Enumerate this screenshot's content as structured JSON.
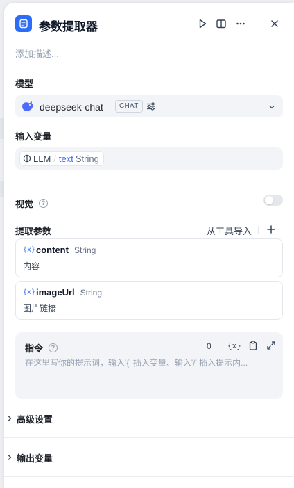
{
  "header": {
    "title": "参数提取器",
    "description_placeholder": "添加描述..."
  },
  "model": {
    "label": "模型",
    "name": "deepseek-chat",
    "mode_badge": "CHAT"
  },
  "input": {
    "label": "输入变量",
    "source_node": "LLM",
    "separator": "/",
    "variable": "text",
    "type": "String"
  },
  "vision": {
    "label": "视觉",
    "enabled": false
  },
  "extract": {
    "label": "提取参数",
    "import_label": "从工具导入",
    "params": [
      {
        "icon": "{x}",
        "name": "content",
        "type": "String",
        "description": "内容"
      },
      {
        "icon": "{x}",
        "name": "imageUrl",
        "type": "String",
        "description": "图片链接"
      }
    ]
  },
  "instruction": {
    "label": "指令",
    "count": "0",
    "var_label": "{x}",
    "placeholder": "在这里写你的提示词，输入'{' 插入变量、输入'/' 插入提示内..."
  },
  "advanced": {
    "label": "高级设置"
  },
  "output": {
    "label": "输出变量"
  },
  "colors": {
    "accent": "#2d6cf6",
    "field_bg": "#f2f4f7"
  }
}
